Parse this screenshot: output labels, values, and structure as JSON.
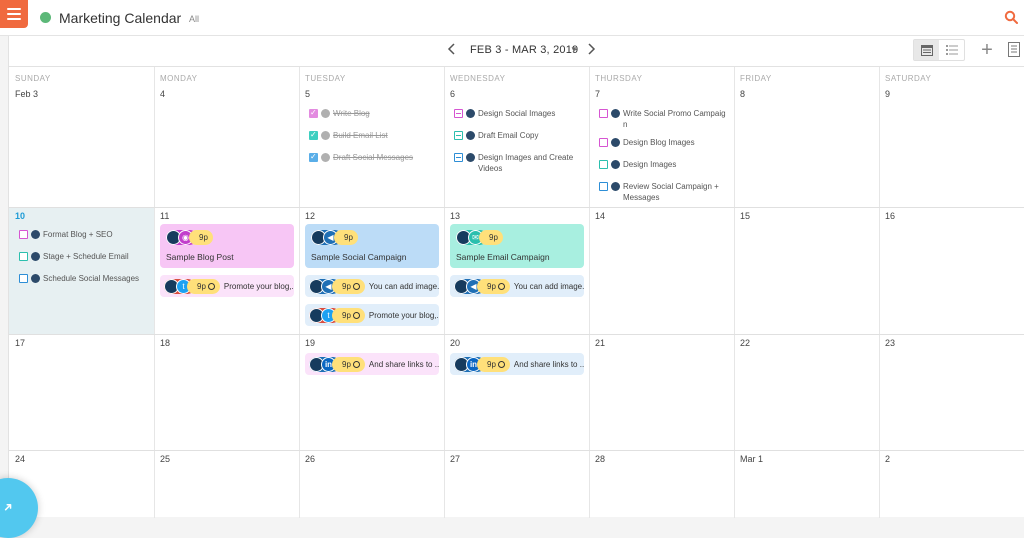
{
  "app": {
    "title": "Marketing Calendar",
    "subtitle": "All"
  },
  "toolbar": {
    "range": "FEB 3 - MAR 3, 2019",
    "add": "+"
  },
  "days": [
    "SUNDAY",
    "MONDAY",
    "TUESDAY",
    "WEDNESDAY",
    "THURSDAY",
    "FRIDAY",
    "SATURDAY"
  ],
  "weeks": [
    [
      "Feb 3",
      "4",
      "5",
      "6",
      "7",
      "8",
      "9"
    ],
    [
      "10",
      "11",
      "12",
      "13",
      "14",
      "15",
      "16"
    ],
    [
      "17",
      "18",
      "19",
      "20",
      "21",
      "22",
      "23"
    ],
    [
      "24",
      "25",
      "26",
      "27",
      "28",
      "Mar 1",
      "2"
    ]
  ],
  "tasks": {
    "tue5": [
      "Write Blog",
      "Build Email List",
      "Draft Social Messages"
    ],
    "wed6": [
      "Design Social Images",
      "Draft Email Copy",
      "Design Images and Create Videos"
    ],
    "thu7": [
      "Write Social Promo Campaign",
      "Design Blog Images",
      "Design Images",
      "Review Social Campaign + Messages"
    ],
    "sun10": [
      "Format Blog + SEO",
      "Stage + Schedule Email",
      "Schedule Social Messages"
    ]
  },
  "cards": {
    "blog": {
      "title": "Sample Blog Post",
      "time": "9p"
    },
    "social": {
      "title": "Sample Social Campaign",
      "time": "9p"
    },
    "email": {
      "title": "Sample Email Campaign",
      "time": "9p"
    }
  },
  "posts": {
    "mon11": {
      "time": "9p",
      "text": "Promote your blog,..."
    },
    "tue12a": {
      "time": "9p",
      "text": "You can add image..."
    },
    "tue12b": {
      "time": "9p",
      "text": "Promote your blog,..."
    },
    "wed13": {
      "time": "9p",
      "text": "You can add image..."
    },
    "tue19": {
      "time": "9p",
      "text": "And share links to ..."
    },
    "wed20": {
      "time": "9p",
      "text": "And share links to ..."
    }
  },
  "colors": {
    "accent": "#f06a3f",
    "blog": "#f7c6f5",
    "social": "#bcdcf7",
    "email": "#a8efe0",
    "blogPost": "#fbe3fa",
    "socialPost": "#e1eefa",
    "today": "#e7f0f2",
    "time": "#ffe07a"
  },
  "icons": {
    "menu": "hamburger-icon",
    "search": "search-icon",
    "prev": "chevron-left-icon",
    "next": "chevron-right-icon"
  }
}
